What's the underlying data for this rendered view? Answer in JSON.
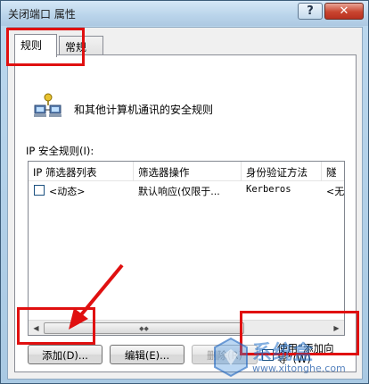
{
  "window": {
    "title": "关闭端口 属性",
    "help_label": "?",
    "close_label": "✕"
  },
  "tabs": [
    {
      "label": "规则",
      "active": true
    },
    {
      "label": "常规",
      "active": false
    }
  ],
  "description": "和其他计算机通讯的安全规则",
  "rules_label": "IP 安全规则(I):",
  "table": {
    "columns": [
      "IP 筛选器列表",
      "筛选器操作",
      "身份验证方法",
      "隧"
    ],
    "rows": [
      {
        "checked": false,
        "filter_list": "<动态>",
        "filter_action": "默认响应(仅限于...",
        "auth_method": "Kerberos",
        "tunnel": "<无"
      }
    ]
  },
  "scrollbar": {
    "left_arrow": "◀",
    "right_arrow": "▶",
    "thumb_grip": "◆◆"
  },
  "buttons": {
    "add": "添加(D)...",
    "edit": "编辑(E)...",
    "remove": "删除(R)"
  },
  "wizard_checkbox": {
    "label": "使用“添加向导”(W)",
    "checked": false
  },
  "watermark": {
    "brand": "系统盒",
    "url": "www.xitonghe.com"
  },
  "colors": {
    "annotation_red": "#e01010",
    "titlebar": "#b9d4ea",
    "close_button": "#c9452f"
  }
}
